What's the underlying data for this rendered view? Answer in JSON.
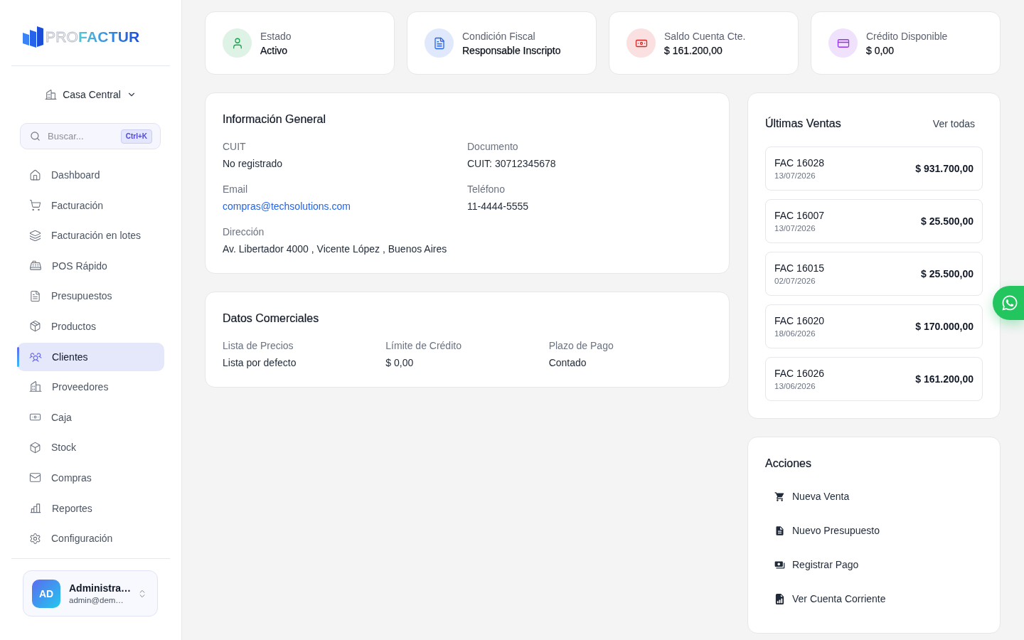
{
  "sidebar": {
    "logo": {
      "part_1": "PRO",
      "part_2": "FACTUR"
    },
    "branch_selector": {
      "label": "Casa Central"
    },
    "search": {
      "placeholder": "Buscar...",
      "shortcut": "Ctrl+K"
    },
    "nav_items": [
      {
        "label": "Dashboard",
        "selected": false
      },
      {
        "label": "Facturación",
        "selected": false
      },
      {
        "label": "Facturación en lotes",
        "selected": false
      },
      {
        "label": "POS Rápido",
        "selected": false
      },
      {
        "label": "Presupuestos",
        "selected": false
      },
      {
        "label": "Productos",
        "selected": false
      },
      {
        "label": "Clientes",
        "selected": true
      },
      {
        "label": "Proveedores",
        "selected": false
      },
      {
        "label": "Caja",
        "selected": false
      },
      {
        "label": "Stock",
        "selected": false
      },
      {
        "label": "Compras",
        "selected": false
      },
      {
        "label": "Reportes",
        "selected": false
      },
      {
        "label": "Configuración",
        "selected": false
      }
    ],
    "user": {
      "initials": "AD",
      "name": "Administra…",
      "email": "admin@dem…"
    }
  },
  "stats": [
    {
      "label": "Estado",
      "value": "Activo",
      "color": "#16a34a"
    },
    {
      "label": "Condición Fiscal",
      "value": "Responsable Inscripto",
      "color": "#2563eb"
    },
    {
      "label": "Saldo Cuenta Cte.",
      "value": "$ 161.200,00",
      "color": "#dc2626"
    },
    {
      "label": "Crédito Disponible",
      "value": "$ 0,00",
      "color": "#9333ea"
    }
  ],
  "general_info": {
    "title": "Información General",
    "fields": [
      {
        "label": "CUIT",
        "value": "No registrado",
        "kind": "text"
      },
      {
        "label": "Documento",
        "value": "CUIT: 30712345678",
        "kind": "text"
      },
      {
        "label": "Email",
        "value": "compras@techsolutions.com",
        "kind": "link"
      },
      {
        "label": "Teléfono",
        "value": "11-4444-5555",
        "kind": "text"
      },
      {
        "label": "Dirección",
        "value": "Av. Libertador 4000 , Vicente López , Buenos Aires",
        "kind": "text"
      }
    ]
  },
  "commercial_data": {
    "title": "Datos Comerciales",
    "fields": [
      {
        "label": "Lista de Precios",
        "value": "Lista por defecto",
        "kind": "text"
      },
      {
        "label": "Límite de Crédito",
        "value": "$ 0,00",
        "kind": "text"
      },
      {
        "label": "Plazo de Pago",
        "value": "Contado",
        "kind": "text"
      }
    ]
  },
  "recent_sales": {
    "title": "Últimas Ventas",
    "link": "Ver todas",
    "items": [
      {
        "number": "FAC 16028",
        "date": "13/07/2026",
        "amount": "$ 931.700,00"
      },
      {
        "number": "FAC 16007",
        "date": "13/07/2026",
        "amount": "$ 25.500,00"
      },
      {
        "number": "FAC 16015",
        "date": "02/07/2026",
        "amount": "$ 25.500,00"
      },
      {
        "number": "FAC 16020",
        "date": "18/06/2026",
        "amount": "$ 170.000,00"
      },
      {
        "number": "FAC 16026",
        "date": "13/06/2026",
        "amount": "$ 161.200,00"
      }
    ]
  },
  "actions": {
    "title": "Acciones",
    "items": [
      "Nueva Venta",
      "Nuevo Presupuesto",
      "Registrar Pago",
      "Ver Cuenta Corriente"
    ]
  }
}
